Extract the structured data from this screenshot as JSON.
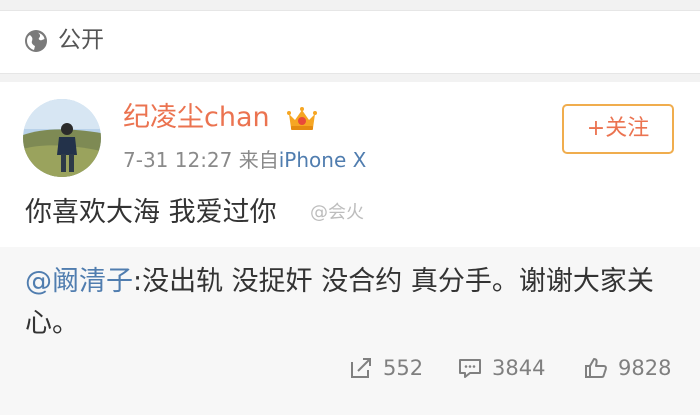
{
  "privacy": {
    "icon": "globe-icon",
    "label": "公开"
  },
  "post": {
    "username": "纪凌尘chan",
    "badge_icon": "crown-vip-icon",
    "time": "7-31 12:27",
    "source_prefix": "来自",
    "source_device": "iPhone X",
    "follow_label": "+关注",
    "text": "你喜欢大海 我爱过你",
    "watermark": "@会火"
  },
  "repost": {
    "mention": "@阚清子",
    "text": ":没出轨 没捉奸 没合约 真分手。谢谢大家关心。",
    "counts": {
      "repost": "552",
      "comment": "3844",
      "like": "9828"
    }
  },
  "colors": {
    "accent_orange": "#eb7350",
    "link_blue": "#507daf",
    "follow_border": "#f0ad4e"
  }
}
